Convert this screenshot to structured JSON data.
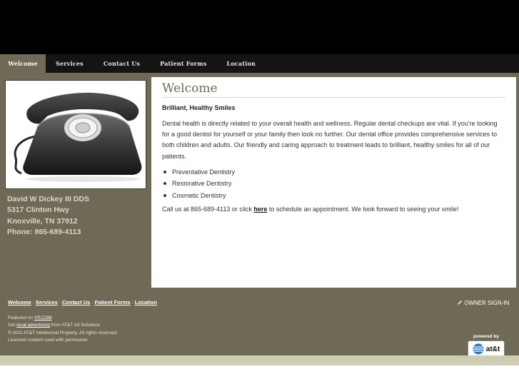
{
  "nav": {
    "items": [
      {
        "label": "Welcome",
        "active": true
      },
      {
        "label": "Services",
        "active": false
      },
      {
        "label": "Contact Us",
        "active": false
      },
      {
        "label": "Patient Forms",
        "active": false
      },
      {
        "label": "Location",
        "active": false
      }
    ]
  },
  "sidebar": {
    "name": "David W Dickey III DDS",
    "address": "5317 Clinton Hwy",
    "city": "Knoxville, TN 37912",
    "phone": "Phone: 865-689-4113",
    "image_icon": "telephone-icon"
  },
  "content": {
    "title": "Welcome",
    "subtitle": "Brilliant, Healthy Smiles",
    "body": "Dental health is directly related to your overall health and wellness. Regular dental checkups are vital. If you're looking for a good dentist for yourself or your family then look no further. Our dental office provides comprehensive services to both children and adults. Our friendly and caring approach to treatment leads to brilliant, healthy smiles for all of our patients.",
    "services": [
      "Preventative Dentistry",
      "Restorative Dentistry",
      "Cosmetic Dentistry"
    ],
    "call_prefix": "Call us at 865-689-4113 or click ",
    "call_link": "here",
    "call_suffix": " to schedule an appointment. We look forward to seeing your smile!"
  },
  "footer": {
    "nav": [
      "Welcome",
      "Services",
      "Contact Us",
      "Patient Forms",
      "Location"
    ],
    "separator": ":",
    "owner_signin": "OWNER SIGN-IN",
    "featured_prefix": "Featured on ",
    "featured_link": "YP.COM",
    "get_prefix": "Get ",
    "get_link": "local advertising",
    "get_suffix": " from AT&T Ad Solutions",
    "copyright": "© 2011 AT&T Intellectual Property. All rights reserved.",
    "licensed": "Licensed content used with permission.",
    "powered_by": "powered by",
    "brand": "at&t"
  },
  "colors": {
    "band": "#6f6a55",
    "nav_bg": "#141414",
    "banner": "#000000",
    "stripe": "#cfccb4"
  }
}
